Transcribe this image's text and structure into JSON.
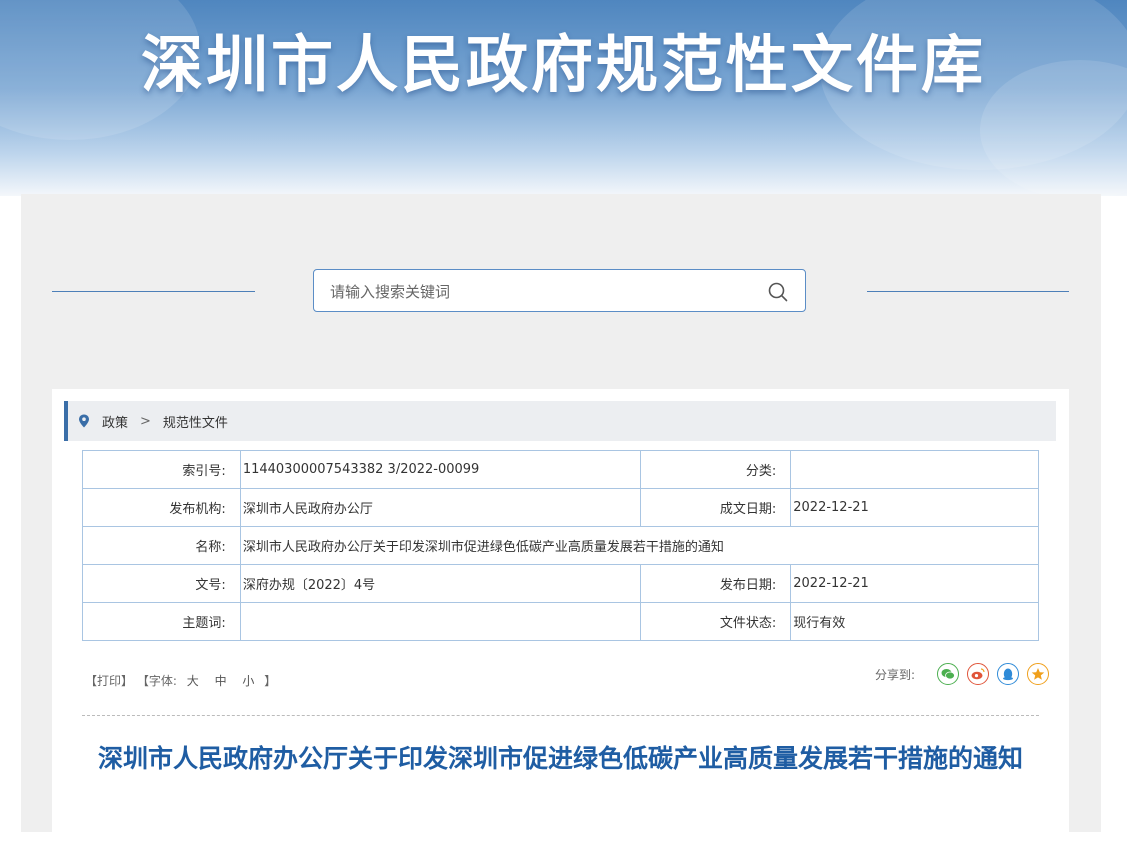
{
  "banner": {
    "title": "深圳市人民政府规范性文件库"
  },
  "search": {
    "placeholder": "请输入搜索关键词"
  },
  "breadcrumb": {
    "items": [
      "政策",
      "规范性文件"
    ],
    "separator": ">"
  },
  "info": {
    "index_label": "索引号:",
    "index_value": "11440300007543382 3/2022-00099",
    "category_label": "分类:",
    "category_value": "",
    "publisher_label": "发布机构:",
    "publisher_value": "深圳市人民政府办公厅",
    "created_label": "成文日期:",
    "created_value": "2022-12-21",
    "name_label": "名称:",
    "name_value": "深圳市人民政府办公厅关于印发深圳市促进绿色低碳产业高质量发展若干措施的通知",
    "docno_label": "文号:",
    "docno_value": "深府办规〔2022〕4号",
    "pubdate_label": "发布日期:",
    "pubdate_value": "2022-12-21",
    "subject_label": "主题词:",
    "subject_value": "",
    "status_label": "文件状态:",
    "status_value": "现行有效"
  },
  "tools": {
    "print": "【打印】",
    "font_prefix": "【字体:",
    "large": "大",
    "medium": "中",
    "small": "小",
    "font_suffix": "】"
  },
  "share": {
    "label": "分享到:",
    "icons": [
      "wechat-icon",
      "weibo-icon",
      "qq-icon",
      "qzone-icon"
    ],
    "colors": {
      "wechat": "#4caf50",
      "weibo": "#e0553a",
      "qq": "#2f8bd8",
      "qzone": "#f0a01c"
    }
  },
  "document": {
    "title": "深圳市人民政府办公厅关于印发深圳市促进绿色低碳产业高质量发展若干措施的通知"
  },
  "colors": {
    "accent": "#3a6ea8",
    "title": "#1f5da3",
    "border": "#a9c5e2",
    "panel": "#efefef"
  }
}
